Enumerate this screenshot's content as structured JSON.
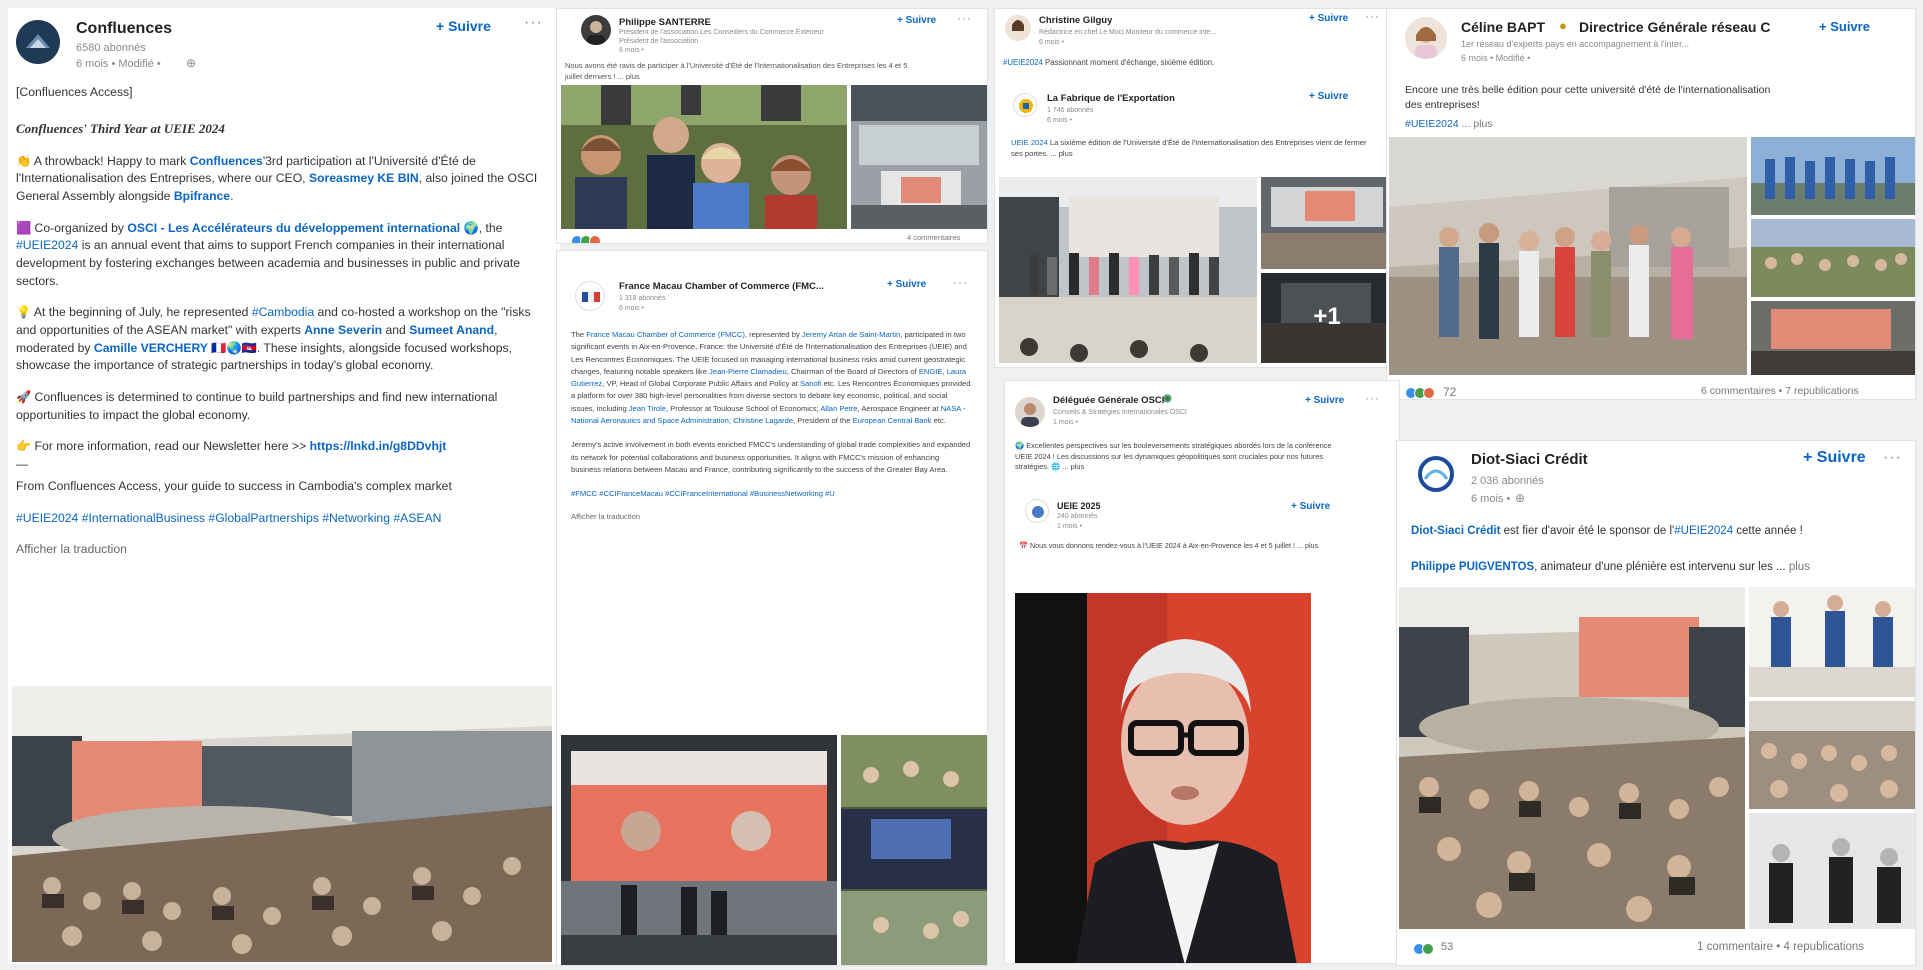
{
  "follow_label": "+ Suivre",
  "more_label": "···",
  "c1": {
    "name": "Confluences",
    "followers": "6580 abonnés",
    "meta": "6 mois • Modifié •",
    "access": "[Confluences Access]",
    "third_year": "Confluences' Third Year at UEIE 2024",
    "p1_a": "👏 A throwback! Happy to mark ",
    "p1_link1": "Confluences",
    "p1_b": "'3rd participation at l'Université d'Été de l'Internationalisation des Entreprises, where our CEO, ",
    "p1_link2": "Soreasmey KE BIN",
    "p1_c": ", also joined the OSCI General Assembly alongside ",
    "p1_link3": "Bpifrance",
    "p1_d": ".",
    "p2_a": "🟪 Co-organized by ",
    "p2_link1": "OSCI - Les Accélérateurs du développement international",
    "p2_b": " 🌍, the ",
    "p2_tag": "#UEIE2024",
    "p2_c": " is an annual event that aims to support French companies in their international development by fostering exchanges between academia and businesses in public and private sectors.",
    "p3_a": "💡 At the beginning of July, he represented ",
    "p3_tag": "#Cambodia",
    "p3_b": " and co-hosted a workshop on the \"risks and opportunities of the ASEAN market\" with experts ",
    "p3_link1": "Anne Severin",
    "p3_c": " and ",
    "p3_link2": "Sumeet Anand",
    "p3_d": ", moderated by ",
    "p3_link3": "Camille VERCHERY",
    "p3_e": " 🇫🇷🌏🇰🇭. These insights, alongside focused workshops, showcase the importance of strategic partnerships in today's global economy.",
    "p4": "🚀 Confluences is determined to continue to build partnerships and find new international opportunities to impact the global economy.",
    "p5_a": "👉 For more information, read our Newsletter here >> ",
    "p5_link": "https://lnkd.in/g8DDvhjt",
    "divider": "—",
    "p6": "From Confluences Access, your guide to success in Cambodia's complex market",
    "hashtags": "#UEIE2024 #InternationalBusiness #GlobalPartnerships #Networking #ASEAN",
    "translate": "Afficher la traduction"
  },
  "c2": {
    "name": "Philippe SANTERRE",
    "meta1": "Président de l'association Les Conseillers du Commerce Extérieur",
    "meta2": "Président de l'association",
    "meta3": "6 mois •",
    "text": "Nous avons été ravis de participer à l'Université d'Été de l'Internationalisation des Entreprises les 4 et 5 juillet derniers ! ... plus",
    "comments": "4 commentaires"
  },
  "c3": {
    "name": "France Macau Chamber of Commerce (FMC...",
    "followers": "1 318 abonnés",
    "meta": "6 mois •",
    "body_a": "The ",
    "body_l1": "France Macau Chamber of Commerce (FMCC)",
    "body_b": ", represented by ",
    "body_l2": "Jeremy Artan de Saint-Martin",
    "body_c": ", participated in two significant events in Aix-en-Provence, France: the Université d'Été de l'Internationalisation des Entreprises (UEIE) and Les Rencontres Économiques. The UEIE focused on managing international business risks amid current geostrategic changes, featuring notable speakers like ",
    "body_l3": "Jean-Pierre Clamadieu",
    "body_d": ", Chairman of the Board of Directors of ",
    "body_l4": "ENGIE",
    "body_e": ", ",
    "body_l5": "Laura Gutierrez",
    "body_f": ", VP, Head of Global Corporate Public Affairs and Policy at ",
    "body_l6": "Sanofi",
    "body_g": " etc. Les Rencontres Économiques provided a platform for over 380 high-level personalities from diverse sectors to debate key economic, political, and social issues, including ",
    "body_l7": "Jean Tirole",
    "body_h": ", Professor at Toulouse School of Economics; ",
    "body_l8": "Allan Petre",
    "body_i": ", Aerospace Engineer at ",
    "body_l9": "NASA - National Aeronautics and Space Administration",
    "body_j": "; ",
    "body_l10": "Christine Lagarde",
    "body_k": ", President of the ",
    "body_l11": "European Central Bank",
    "body_l": " etc.",
    "body2": "Jeremy's active involvement in both events enriched FMCC's understanding of global trade complexities and expanded its network for potential collaborations and business opportunities. It aligns with FMCC's mission of enhancing business relations between Macau and France, contributing significantly to the success of the Greater Bay Area.",
    "hashtags": "#FMCC #CCIFranceMacau #CCIFranceInternational #BusinessNetworking #U",
    "translate": "Afficher la traduction"
  },
  "c4": {
    "name": "Christine Gilguy",
    "meta1": "Rédactrice en chef Le Moci Moniteur du commerce inte...",
    "meta2": "6 mois •",
    "text_tag": "#UEIE2024",
    "text": " Passionnant moment d'échange, sixième édition.",
    "inner_name": "La Fabrique de l'Exportation",
    "inner_followers": "1 746 abonnés",
    "inner_meta": "6 mois •",
    "inner_text_tag": "UEIE 2024",
    "inner_text": " La sixième édition de l'Université d'Été de l'Internationalisation des Entreprises vient de fermer ses portes. ... plus",
    "plus_more": "+1"
  },
  "c5": {
    "name": "Céline BAPT",
    "title": "Directrice Générale réseau C",
    "meta1": "1er réseau d'experts pays en accompagnement à l'inter...",
    "meta2": "6 mois • Modifié •",
    "text": "Encore une très belle édition pour cette université d'été de l'internationalisation des entreprises!",
    "tag": "#UEIE2024",
    "more": "... plus",
    "count": "72",
    "footer": "6 commentaires • 7 republications"
  },
  "c6": {
    "name": "Déléguée Générale OSCI",
    "meta1": "Conseils & Stratégies Internationales OSCI",
    "meta2": "1 mois •",
    "text": "🌍 Excellentes perspectives sur les bouleversements stratégiques abordés lors de la conférence UEIE 2024 ! Les discussions sur les dynamiques géopolitiques sont cruciales pour nos futures stratégies. 🌐 ... plus",
    "inner_name": "UEIE 2025",
    "inner_followers": "240 abonnés",
    "inner_meta": "1 mois •",
    "inner_text": "📅 Nous vous donnons rendez-vous à l'UEIE 2024 à Aix-en-Provence les 4 et 5 juillet ! ... plus"
  },
  "c7": {
    "name": "Diot-Siaci Crédit",
    "followers": "2 036 abonnés",
    "meta": "6 mois •",
    "t1_link": "Diot-Siaci Crédit",
    "t1_a": " est fier d'avoir été le sponsor de l'",
    "t1_tag": "#UEIE2024",
    "t1_b": " cette année !",
    "t2_link": "Philippe PUIGVENTOS",
    "t2_a": ", animateur d'une plénière est intervenu sur les ...",
    "more": "plus",
    "count": "53",
    "footer": "1 commentaire • 4 republications"
  }
}
